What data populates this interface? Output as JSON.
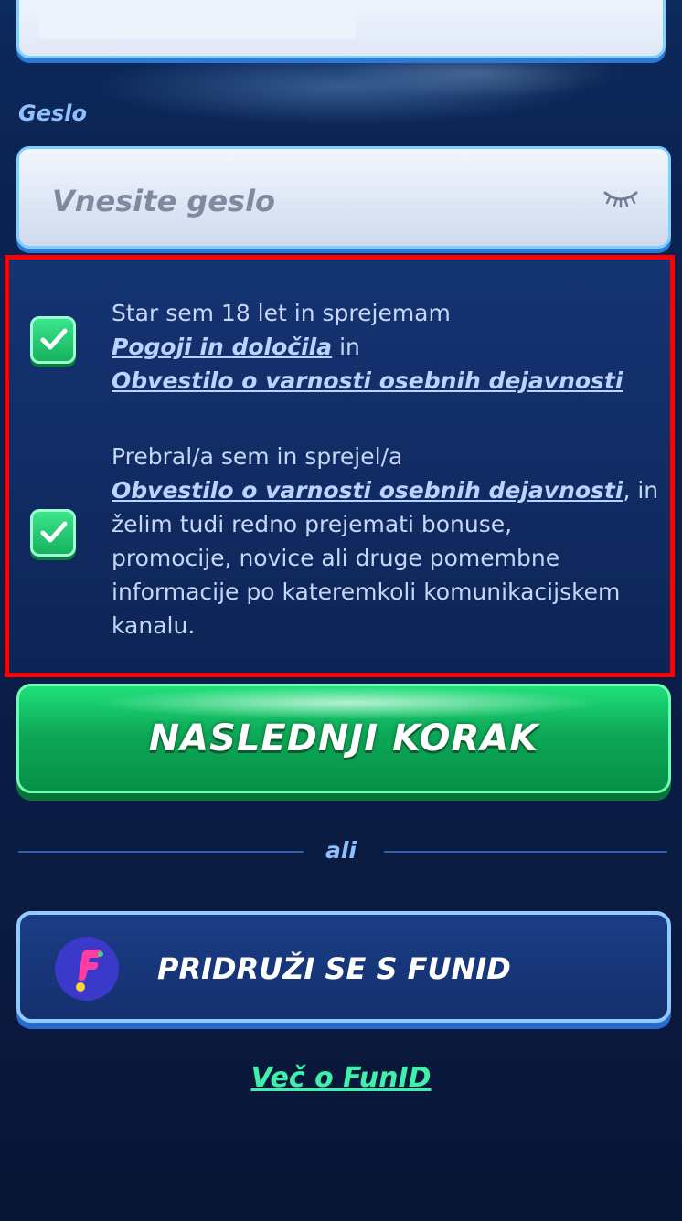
{
  "password": {
    "label": "Geslo",
    "placeholder": "Vnesite geslo",
    "toggle_icon": "eye-closed-icon"
  },
  "consents": [
    {
      "checked": true,
      "text_before": "Star sem 18 let in sprejemam",
      "link1": "Pogoji in določila",
      "text_middle": "in",
      "link2": "Obvestilo o varnosti osebnih dejavnosti"
    },
    {
      "checked": true,
      "text_before": "Prebral/a sem in sprejel/a",
      "link1": "Obvestilo o varnosti osebnih dejavnosti",
      "text_after_link": ", in",
      "line3": "želim tudi redno prejemati bonuse,",
      "line4": "promocije, novice ali druge pomembne",
      "line5": "informacije po kateremkoli komunikacijskem",
      "line6": "kanalu."
    }
  ],
  "next_button": {
    "label": "NASLEDNJI KORAK"
  },
  "divider": {
    "label": "ali"
  },
  "funid_button": {
    "label": "PRIDRUŽI SE S FUNID",
    "icon": "funid-logo-icon"
  },
  "more_link": {
    "label": "Več o FunID"
  },
  "colors": {
    "accent_green": "#1fe07a",
    "link_teal": "#3ff0a8",
    "highlight_border": "#ff0000",
    "label_blue": "#8ec0ff"
  }
}
